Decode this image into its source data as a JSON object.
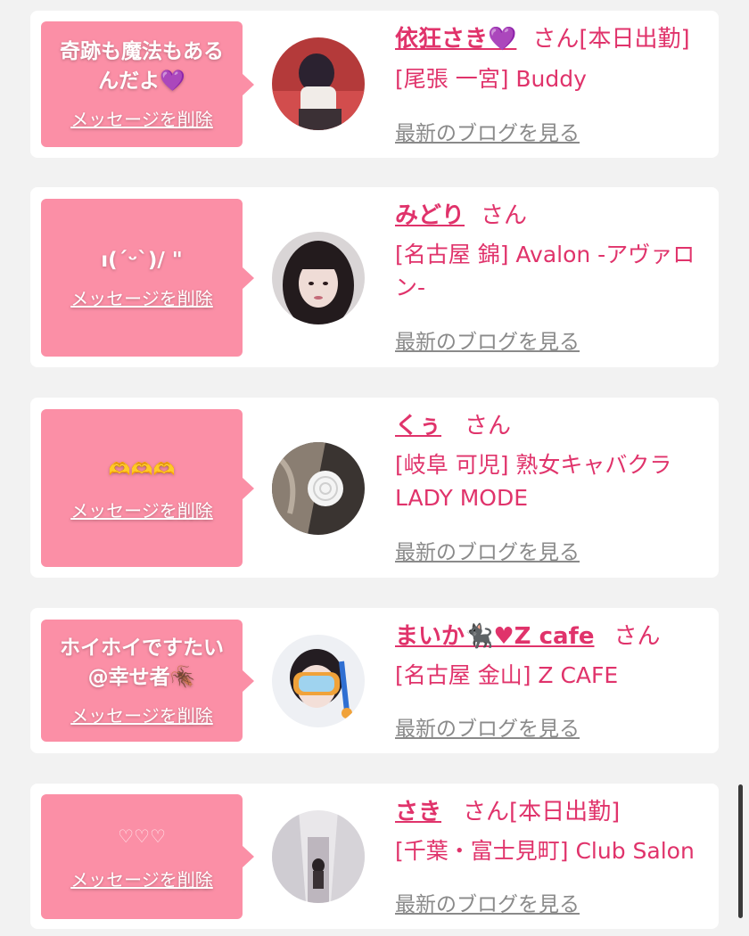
{
  "colors": {
    "accent": "#e0336b",
    "bubble": "#fb8fa6",
    "link_gray": "#8a8a8a"
  },
  "entries": [
    {
      "message": "奇跡も魔法もある\nんだよ💜",
      "delete_label": "メッセージを削除",
      "name": "依狂さき💜",
      "honorific": "さん",
      "tag": "[本日出勤]",
      "shop": "[尾張 一宮] Buddy",
      "blog_label": "最新のブログを見る",
      "avatar_icon": "profile-photo"
    },
    {
      "message": "ı(ˊᵕˋ)/ \"",
      "delete_label": "メッセージを削除",
      "name": "みどり",
      "honorific": "さん",
      "tag": "",
      "shop": "[名古屋 錦] Avalon -アヴァロン-",
      "blog_label": "最新のブログを見る",
      "avatar_icon": "profile-photo"
    },
    {
      "message": "🫶🫶🫶",
      "delete_label": "メッセージを削除",
      "name": "くぅ",
      "honorific": "さん",
      "tag": "",
      "shop": "[岐阜 可児] 熟女キャバクラ LADY MODE",
      "blog_label": "最新のブログを見る",
      "avatar_icon": "profile-photo"
    },
    {
      "message": "ホイホイですたい\n@幸せ者🪳",
      "delete_label": "メッセージを削除",
      "name": "まいか🐈‍⬛♥Z cafe",
      "honorific": "さん",
      "tag": "",
      "shop": "[名古屋 金山] Z CAFE",
      "blog_label": "最新のブログを見る",
      "avatar_icon": "profile-photo"
    },
    {
      "message": "♡♡♡",
      "delete_label": "メッセージを削除",
      "name": "さき",
      "honorific": "さん",
      "tag": "[本日出勤]",
      "shop": "[千葉・富士見町] Club Salon",
      "blog_label": "最新のブログを見る",
      "avatar_icon": "profile-photo"
    }
  ]
}
